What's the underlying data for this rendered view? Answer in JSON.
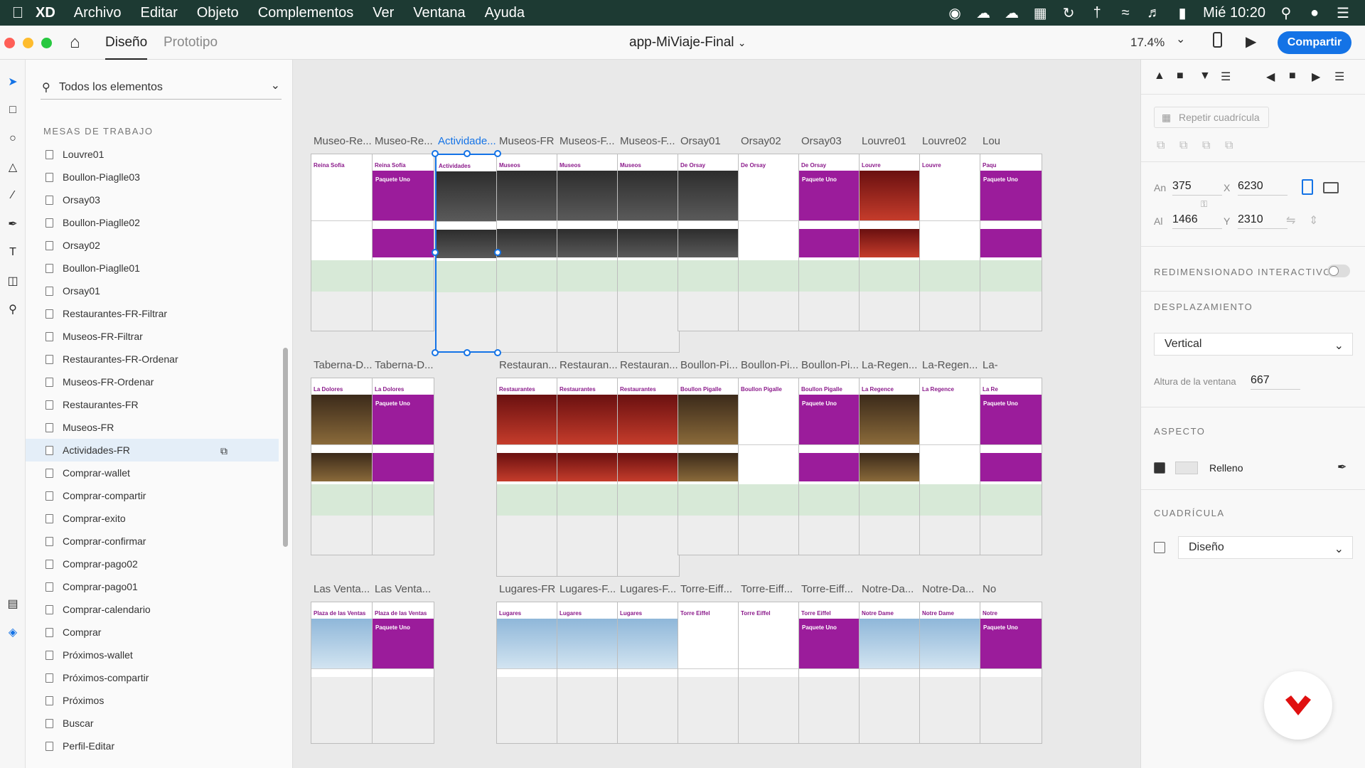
{
  "menubar": {
    "app": "XD",
    "items": [
      "Archivo",
      "Editar",
      "Objeto",
      "Complementos",
      "Ver",
      "Ventana",
      "Ayuda"
    ],
    "clock": "Mié 10:20"
  },
  "titlebar": {
    "tabs": [
      "Diseño",
      "Prototipo"
    ],
    "doc_title": "app-MiViaje-Final",
    "zoom": "17.4%",
    "share_label": "Compartir"
  },
  "layers": {
    "search_placeholder": "Todos los elementos",
    "section_title": "MESAS DE TRABAJO",
    "items": [
      "Louvre01",
      "Boullon-Piaglle03",
      "Orsay03",
      "Boullon-Piaglle02",
      "Orsay02",
      "Boullon-Piaglle01",
      "Orsay01",
      "Restaurantes-FR-Filtrar",
      "Museos-FR-Filtrar",
      "Restaurantes-FR-Ordenar",
      "Museos-FR-Ordenar",
      "Restaurantes-FR",
      "Museos-FR",
      "Actividades-FR",
      "Comprar-wallet",
      "Comprar-compartir",
      "Comprar-exito",
      "Comprar-confirmar",
      "Comprar-pago02",
      "Comprar-pago01",
      "Comprar-calendario",
      "Comprar",
      "Próximos-wallet",
      "Próximos-compartir",
      "Próximos",
      "Buscar",
      "Perfil-Editar"
    ],
    "selected": "Actividades-FR"
  },
  "canvas": {
    "row1_names": [
      "Museo-Re...",
      "Museo-Re...",
      "Actividade...",
      "Museos-FR",
      "Museos-F...",
      "Museos-F...",
      "Orsay01",
      "Orsay02",
      "Orsay03",
      "Louvre01",
      "Louvre02",
      "Lou"
    ],
    "row1_titles": [
      "Reina Sofía",
      "Reina Sofía",
      "Actividades",
      "Museos",
      "Museos",
      "Museos",
      "De Orsay",
      "De Orsay",
      "De Orsay",
      "Louvre",
      "Louvre",
      "Paqu"
    ],
    "row2_names": [
      "Taberna-D...",
      "Taberna-D...",
      "Restauran...",
      "Restauran...",
      "Restauran...",
      "Boullon-Pi...",
      "Boullon-Pi...",
      "Boullon-Pi...",
      "La-Regen...",
      "La-Regen...",
      "La-"
    ],
    "row2_titles": [
      "La Dolores",
      "La Dolores",
      "Restaurantes",
      "Restaurantes",
      "Restaurantes",
      "Boullon Pigalle",
      "Boullon Pigalle",
      "Boullon Pigalle",
      "La Regence",
      "La Regence",
      "La Re"
    ],
    "row3_names": [
      "Las Venta...",
      "Las Venta...",
      "Lugares-FR",
      "Lugares-F...",
      "Lugares-F...",
      "Torre-Eiff...",
      "Torre-Eiff...",
      "Torre-Eiff...",
      "Notre-Da...",
      "Notre-Da...",
      "No"
    ],
    "row3_titles": [
      "Plaza de las Ventas",
      "Plaza de las Ventas",
      "Lugares",
      "Lugares",
      "Lugares",
      "Torre Eiffel",
      "Torre Eiffel",
      "Torre Eiffel",
      "Notre Dame",
      "Notre Dame",
      "Notre"
    ],
    "subtitle": "Paquete Uno"
  },
  "inspector": {
    "repeat_label": "Repetir cuadrícula",
    "w_label": "An",
    "w": "375",
    "x_label": "X",
    "x": "6230",
    "h_label": "Al",
    "h": "1466",
    "y_label": "Y",
    "y": "2310",
    "resize_title": "REDIMENSIONADO INTERACTIVO",
    "scroll_title": "DESPLAZAMIENTO",
    "scroll_value": "Vertical",
    "viewport_label": "Altura de la ventana",
    "viewport_value": "667",
    "appearance_title": "ASPECTO",
    "fill_label": "Relleno",
    "grid_title": "CUADRÍCULA",
    "grid_value": "Diseño"
  },
  "colors": {
    "accent": "#1473e6",
    "brand": "#9b1c9b",
    "menubar": "#1d3a33"
  }
}
